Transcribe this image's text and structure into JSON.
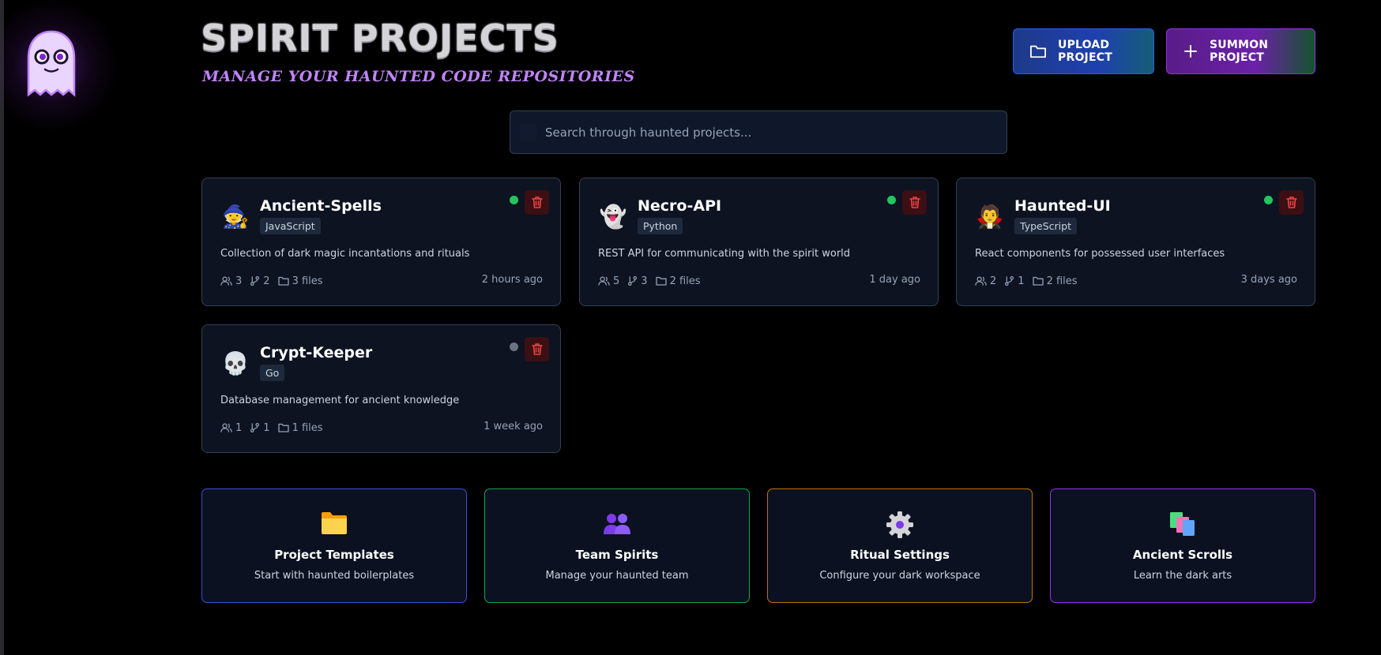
{
  "header": {
    "title": "Spirit Projects",
    "subtitle": "Manage your haunted code repositories"
  },
  "actions": {
    "upload_label": "Upload Project",
    "summon_label": "Summon Project"
  },
  "search": {
    "placeholder": "Search through haunted projects...",
    "value": ""
  },
  "projects": [
    {
      "emoji": "🧙",
      "name": "Ancient-Spells",
      "language": "JavaScript",
      "description": "Collection of dark magic incantations and rituals",
      "members": "3",
      "branches": "2",
      "files": "3 files",
      "updated": "2 hours ago",
      "status_color": "#22c55e"
    },
    {
      "emoji": "👻",
      "name": "Necro-API",
      "language": "Python",
      "description": "REST API for communicating with the spirit world",
      "members": "5",
      "branches": "3",
      "files": "2 files",
      "updated": "1 day ago",
      "status_color": "#22c55e"
    },
    {
      "emoji": "🧛",
      "name": "Haunted-UI",
      "language": "TypeScript",
      "description": "React components for possessed user interfaces",
      "members": "2",
      "branches": "1",
      "files": "2 files",
      "updated": "3 days ago",
      "status_color": "#22c55e"
    },
    {
      "emoji": "💀",
      "name": "Crypt-Keeper",
      "language": "Go",
      "description": "Database management for ancient knowledge",
      "members": "1",
      "branches": "1",
      "files": "1 files",
      "updated": "1 week ago",
      "status_color": "#6b7280"
    }
  ],
  "quick_actions": [
    {
      "icon": "folder-icon",
      "title": "Project Templates",
      "subtitle": "Start with haunted boilerplates",
      "border_color": "#3b4fd8"
    },
    {
      "icon": "team-icon",
      "title": "Team Spirits",
      "subtitle": "Manage your haunted team",
      "border_color": "#16a34a"
    },
    {
      "icon": "gear-icon",
      "title": "Ritual Settings",
      "subtitle": "Configure your dark workspace",
      "border_color": "#c2720c"
    },
    {
      "icon": "books-icon",
      "title": "Ancient Scrolls",
      "subtitle": "Learn the dark arts",
      "border_color": "#9333ea"
    }
  ],
  "colors": {
    "delete_icon": "#ef4444",
    "delete_bg": "#3b0f14",
    "card_bg": "#0d1321",
    "accent_purple": "#c084fc"
  }
}
